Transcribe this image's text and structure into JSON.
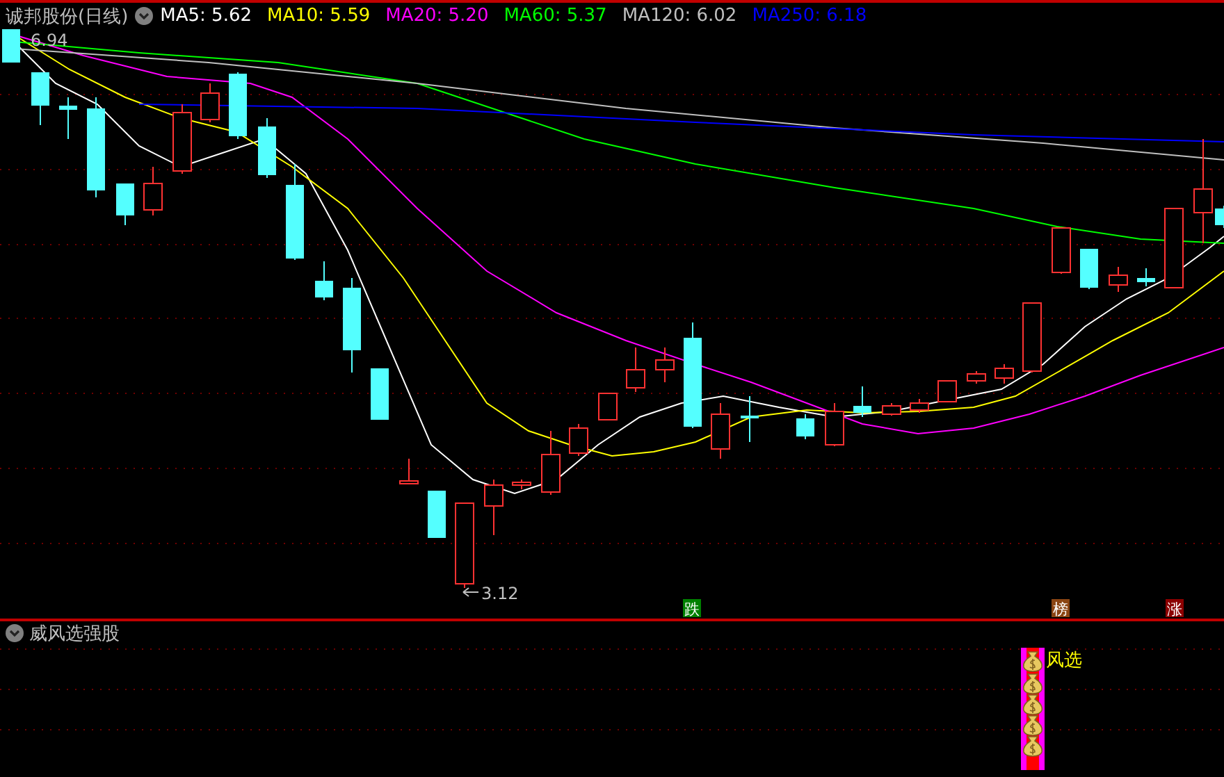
{
  "header": {
    "title": "诚邦股份(日线)",
    "indicators": [
      {
        "label": "MA5:",
        "value": "5.62",
        "color": "#ffffff"
      },
      {
        "label": "MA10:",
        "value": "5.59",
        "color": "#ffff00"
      },
      {
        "label": "MA20:",
        "value": "5.20",
        "color": "#ff00ff"
      },
      {
        "label": "MA60:",
        "value": "5.37",
        "color": "#00ff00"
      },
      {
        "label": "MA120:",
        "value": "6.02",
        "color": "#c0c0c0"
      },
      {
        "label": "MA250:",
        "value": "6.18",
        "color": "#0000ff"
      }
    ]
  },
  "main_chart": {
    "high_label": "6.94",
    "low_label": "3.12",
    "signals": [
      {
        "text": "跌",
        "color": "#008000"
      },
      {
        "text": "榜",
        "color": "#8b4513"
      },
      {
        "text": "涨",
        "color": "#8b0000"
      }
    ]
  },
  "sub_panel": {
    "title": "威风选强股",
    "signal_label": "风选"
  }
}
